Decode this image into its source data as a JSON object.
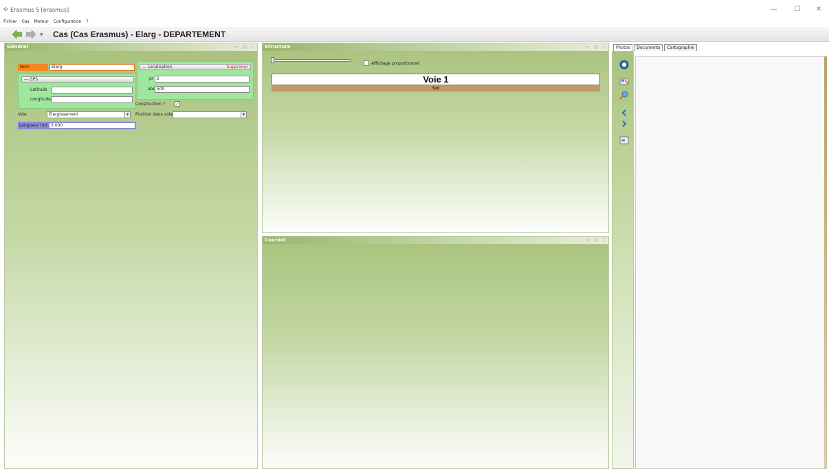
{
  "window": {
    "title": "Erasmus 5 [erasmus]",
    "minimize": "—",
    "maximize": "☐",
    "close": "✕"
  },
  "menu": [
    "Fichier",
    "Cas",
    "Moteur",
    "Configuration",
    "?"
  ],
  "nav": {
    "title": "Cas (Cas Erasmus) - Elarg - DEPARTEMENT",
    "dropdown": "▼"
  },
  "panels": {
    "general": {
      "title": "Général"
    },
    "structure": {
      "title": "Structure"
    },
    "courant": {
      "title": "Courant"
    },
    "tools": [
      "⇦",
      "▤",
      "⛶"
    ]
  },
  "general": {
    "nom_label": "Nom",
    "nom_value": "Elarg",
    "gps": {
      "header": "— GPS",
      "latitude_label": "Latitude",
      "latitude_value": "",
      "longitude_label": "Longitude",
      "longitude_value": ""
    },
    "localisation": {
      "header": "— Localisation",
      "delete": "Supprimer",
      "pr_label": "pr",
      "pr_value": "2",
      "abs_label": "abs",
      "abs_value": "500"
    },
    "construction_label": "Construction ?",
    "construction_checked": true,
    "voie_label": "Voie",
    "voie_value": "Elargissement",
    "position_label": "Position dans voie",
    "position_value": "",
    "longueur_label": "Longueur (m)",
    "longueur_value": "3 000"
  },
  "structure": {
    "affichage_label": "Affichage proportionnel",
    "affichage_checked": false,
    "voie_title": "Voie 1",
    "sol_label": "Sol"
  },
  "right": {
    "tabs": [
      "Photos",
      "Documents",
      "Cartographie"
    ],
    "active_tab": "Photos",
    "tools": [
      "camera-icon",
      "map-pin-icon",
      "globe-search-icon",
      "chevron-left-icon",
      "chevron-right-icon",
      "image-icon"
    ]
  },
  "colors": {
    "nom_accent": "#f08a1e",
    "gps_green": "#9fe69f",
    "longueur_accent": "#8a8ad8",
    "sol_brown": "#c39869",
    "delete_red": "#d42020",
    "panel_green": "#a8c27c"
  }
}
